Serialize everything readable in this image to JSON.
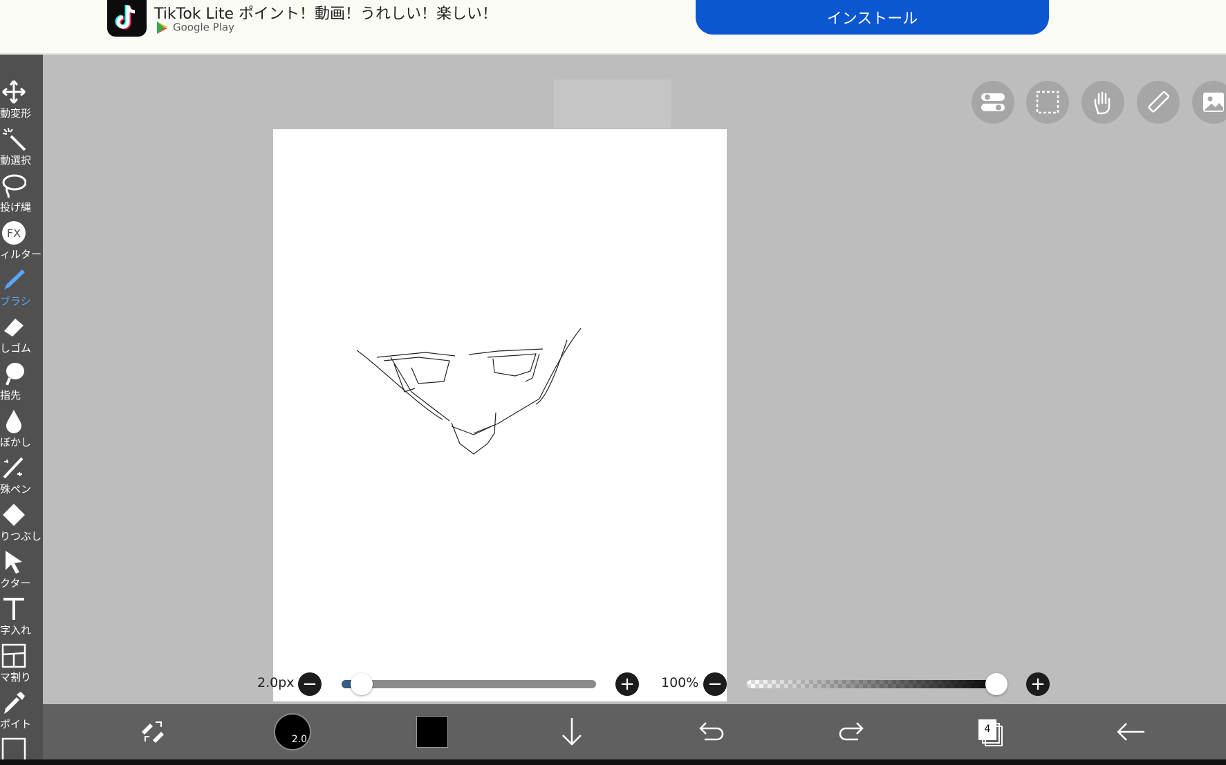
{
  "ad": {
    "app_name": "TikTok Lite",
    "title": "TikTok Lite ポイント！動画！うれしい！楽しい！",
    "store": "Google Play",
    "install_label": "インストール",
    "install_color": "#0b57d0"
  },
  "tools": [
    {
      "label": "動変形",
      "icon": "move-transform-icon",
      "active": false
    },
    {
      "label": "動選択",
      "icon": "magic-wand-icon",
      "active": false
    },
    {
      "label": "投げ縄",
      "icon": "lasso-icon",
      "active": false
    },
    {
      "label": "ィルター",
      "icon": "fx-filter-icon",
      "active": false
    },
    {
      "label": "ブラシ",
      "icon": "brush-icon",
      "active": true
    },
    {
      "label": "しゴム",
      "icon": "eraser-icon",
      "active": false
    },
    {
      "label": "指先",
      "icon": "smudge-finger-icon",
      "active": false
    },
    {
      "label": "ぼかし",
      "icon": "blur-drop-icon",
      "active": false
    },
    {
      "label": "殊ペン",
      "icon": "special-pen-icon",
      "active": false
    },
    {
      "label": "りつぶし",
      "icon": "fill-bucket-icon",
      "active": false
    },
    {
      "label": "クター",
      "icon": "vector-cursor-icon",
      "active": false
    },
    {
      "label": "字入れ",
      "icon": "text-icon",
      "active": false
    },
    {
      "label": "マ割り",
      "icon": "frame-divider-icon",
      "active": false
    },
    {
      "label": "ポイト",
      "icon": "eyedropper-icon",
      "active": false
    }
  ],
  "top_icons": [
    "toggle-switches-icon",
    "selection-rect-icon",
    "hand-gesture-icon",
    "ruler-icon",
    "image-icon"
  ],
  "brush": {
    "size_label": "2.0px",
    "size_fraction": 0.04,
    "opacity_label": "100%",
    "opacity_fraction": 1.0,
    "indicator_value": "2.0"
  },
  "bottom_bar": {
    "current_color": "#000000",
    "layer_count": "4",
    "items": [
      "swap-tool-icon",
      "brush-size-indicator",
      "color-swatch",
      "download-arrow-icon",
      "undo-icon",
      "redo-icon",
      "layers-icon",
      "back-arrow-icon"
    ]
  },
  "colors": {
    "workspace_bg": "#bdbdbd",
    "toolbar_bg": "#505050",
    "active_tool": "#5aa7ff",
    "bottom_bar_bg": "#606060"
  }
}
